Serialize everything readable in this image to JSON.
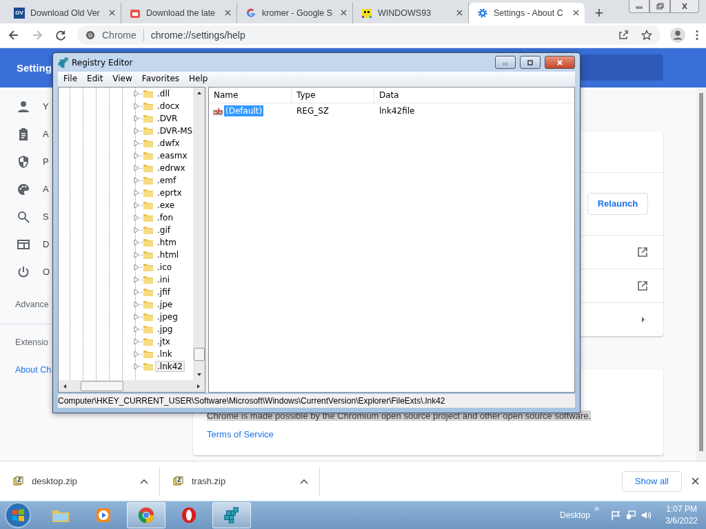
{
  "browser": {
    "tabs": [
      {
        "title": "Download Old Ver",
        "favicon_text": "OV",
        "selected": false
      },
      {
        "title": "Download the late",
        "selected": false
      },
      {
        "title": "kromer - Google S",
        "selected": false
      },
      {
        "title": "WINDOWS93",
        "selected": false
      },
      {
        "title": "Settings - About C",
        "selected": true
      }
    ],
    "new_tab": "+",
    "nav": {
      "back_disabled": false,
      "forward_disabled": true
    },
    "omnibox": {
      "site_label": "Chrome",
      "url": "chrome://settings/help"
    }
  },
  "settings": {
    "header_title": "Setting",
    "sidebar": [
      {
        "label": "Y",
        "selected": false
      },
      {
        "label": "A",
        "selected": false
      },
      {
        "label": "P",
        "selected": false
      },
      {
        "label": "A",
        "selected": false
      },
      {
        "label": "S",
        "selected": false
      },
      {
        "label": "D",
        "selected": false
      },
      {
        "label": "O",
        "selected": false
      }
    ],
    "advanced": "Advance",
    "extensions": "Extensio",
    "about": {
      "label": "About Ch",
      "selected": true
    },
    "relaunch": "Relaunch",
    "footer": {
      "text": "Chrome is made possible by the Chromium open source project and other open source software.",
      "terms_link": "Terms of Service"
    }
  },
  "registry": {
    "title": "Registry Editor",
    "menu": [
      "File",
      "Edit",
      "View",
      "Favorites",
      "Help"
    ],
    "keys": [
      {
        "label": ".dll",
        "selected": false
      },
      {
        "label": ".docx",
        "selected": false
      },
      {
        "label": ".DVR",
        "selected": false
      },
      {
        "label": ".DVR-MS",
        "selected": false
      },
      {
        "label": ".dwfx",
        "selected": false
      },
      {
        "label": ".easmx",
        "selected": false
      },
      {
        "label": ".edrwx",
        "selected": false
      },
      {
        "label": ".emf",
        "selected": false
      },
      {
        "label": ".eprtx",
        "selected": false
      },
      {
        "label": ".exe",
        "selected": false
      },
      {
        "label": ".fon",
        "selected": false
      },
      {
        "label": ".gif",
        "selected": false
      },
      {
        "label": ".htm",
        "selected": false
      },
      {
        "label": ".html",
        "selected": false
      },
      {
        "label": ".ico",
        "selected": false
      },
      {
        "label": ".ini",
        "selected": false
      },
      {
        "label": ".jfif",
        "selected": false
      },
      {
        "label": ".jpe",
        "selected": false
      },
      {
        "label": ".jpeg",
        "selected": false
      },
      {
        "label": ".jpg",
        "selected": false
      },
      {
        "label": ".jtx",
        "selected": false
      },
      {
        "label": ".lnk",
        "selected": false
      },
      {
        "label": ".lnk42",
        "selected": true
      }
    ],
    "columns": [
      "Name",
      "Type",
      "Data"
    ],
    "values": [
      {
        "name": "(Default)",
        "type": "REG_SZ",
        "data": "lnk42file",
        "selected": true
      }
    ],
    "status": "Computer\\HKEY_CURRENT_USER\\Software\\Microsoft\\Windows\\CurrentVersion\\Explorer\\FileExts\\.lnk42"
  },
  "downloads": {
    "items": [
      {
        "name": "desktop.zip"
      },
      {
        "name": "trash.zip"
      }
    ],
    "show_all": "Show all"
  },
  "taskbar": {
    "apps": [
      {
        "active": false
      },
      {
        "active": false
      },
      {
        "active": true
      },
      {
        "active": false
      },
      {
        "active": true
      }
    ],
    "toolbar_label": "Desktop",
    "chevron": "»",
    "time": "1:07 PM",
    "date": "3/6/2022"
  }
}
